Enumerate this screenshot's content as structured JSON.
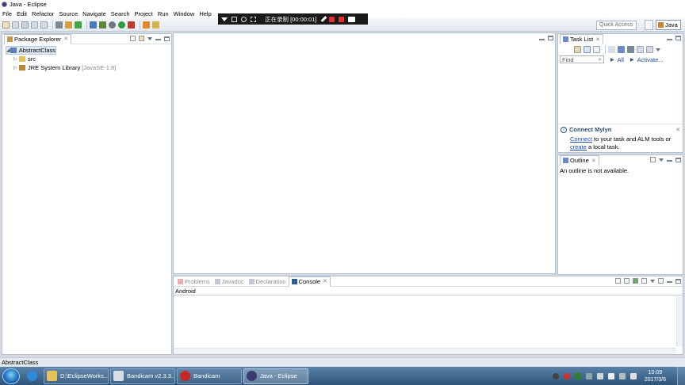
{
  "window": {
    "title": "Java - Eclipse"
  },
  "menu": [
    "File",
    "Edit",
    "Refactor",
    "Source",
    "Navigate",
    "Search",
    "Project",
    "Run",
    "Window",
    "Help"
  ],
  "recorder": {
    "status": "正在录制 [00:00:01]"
  },
  "quick_access": {
    "placeholder": "Quick Access"
  },
  "perspective": {
    "label": "Java"
  },
  "package_explorer": {
    "tab": "Package Explorer",
    "tree": {
      "project": "AbstractClass",
      "children": [
        {
          "label": "src",
          "suffix": ""
        },
        {
          "label": "JRE System Library",
          "suffix": "[JavaSE-1.8]"
        }
      ]
    }
  },
  "task_list": {
    "tab": "Task List",
    "find_placeholder": "Find",
    "all": "All",
    "activate": "Activate..."
  },
  "mylyn": {
    "title": "Connect Mylyn",
    "connect_link": "Connect",
    "line1_rest": " to your task and ALM tools or",
    "create_link": "create",
    "line2_rest": " a local task."
  },
  "outline": {
    "tab": "Outline",
    "message": "An outline is not available."
  },
  "bottom_tabs": [
    {
      "label": "Problems",
      "active": false
    },
    {
      "label": "Javadoc",
      "active": false
    },
    {
      "label": "Declaration",
      "active": false
    },
    {
      "label": "Console",
      "active": true
    }
  ],
  "console": {
    "text": "Android"
  },
  "statusbar": {
    "text": "AbstractClass"
  },
  "taskbar": {
    "items": [
      {
        "label": "D:\\EclipseWorks..."
      },
      {
        "label": "Bandicam v2.3.3..."
      },
      {
        "label": "Bandicam"
      },
      {
        "label": "Java - Eclipse"
      }
    ],
    "clock_time": "10:09",
    "clock_date": "2017/3/6"
  },
  "colors": {
    "accent_blue": "#1a4fa8",
    "record_red": "#e53030",
    "taskbar_bg": "#2e5579",
    "panel_border": "#b7c2cf"
  }
}
